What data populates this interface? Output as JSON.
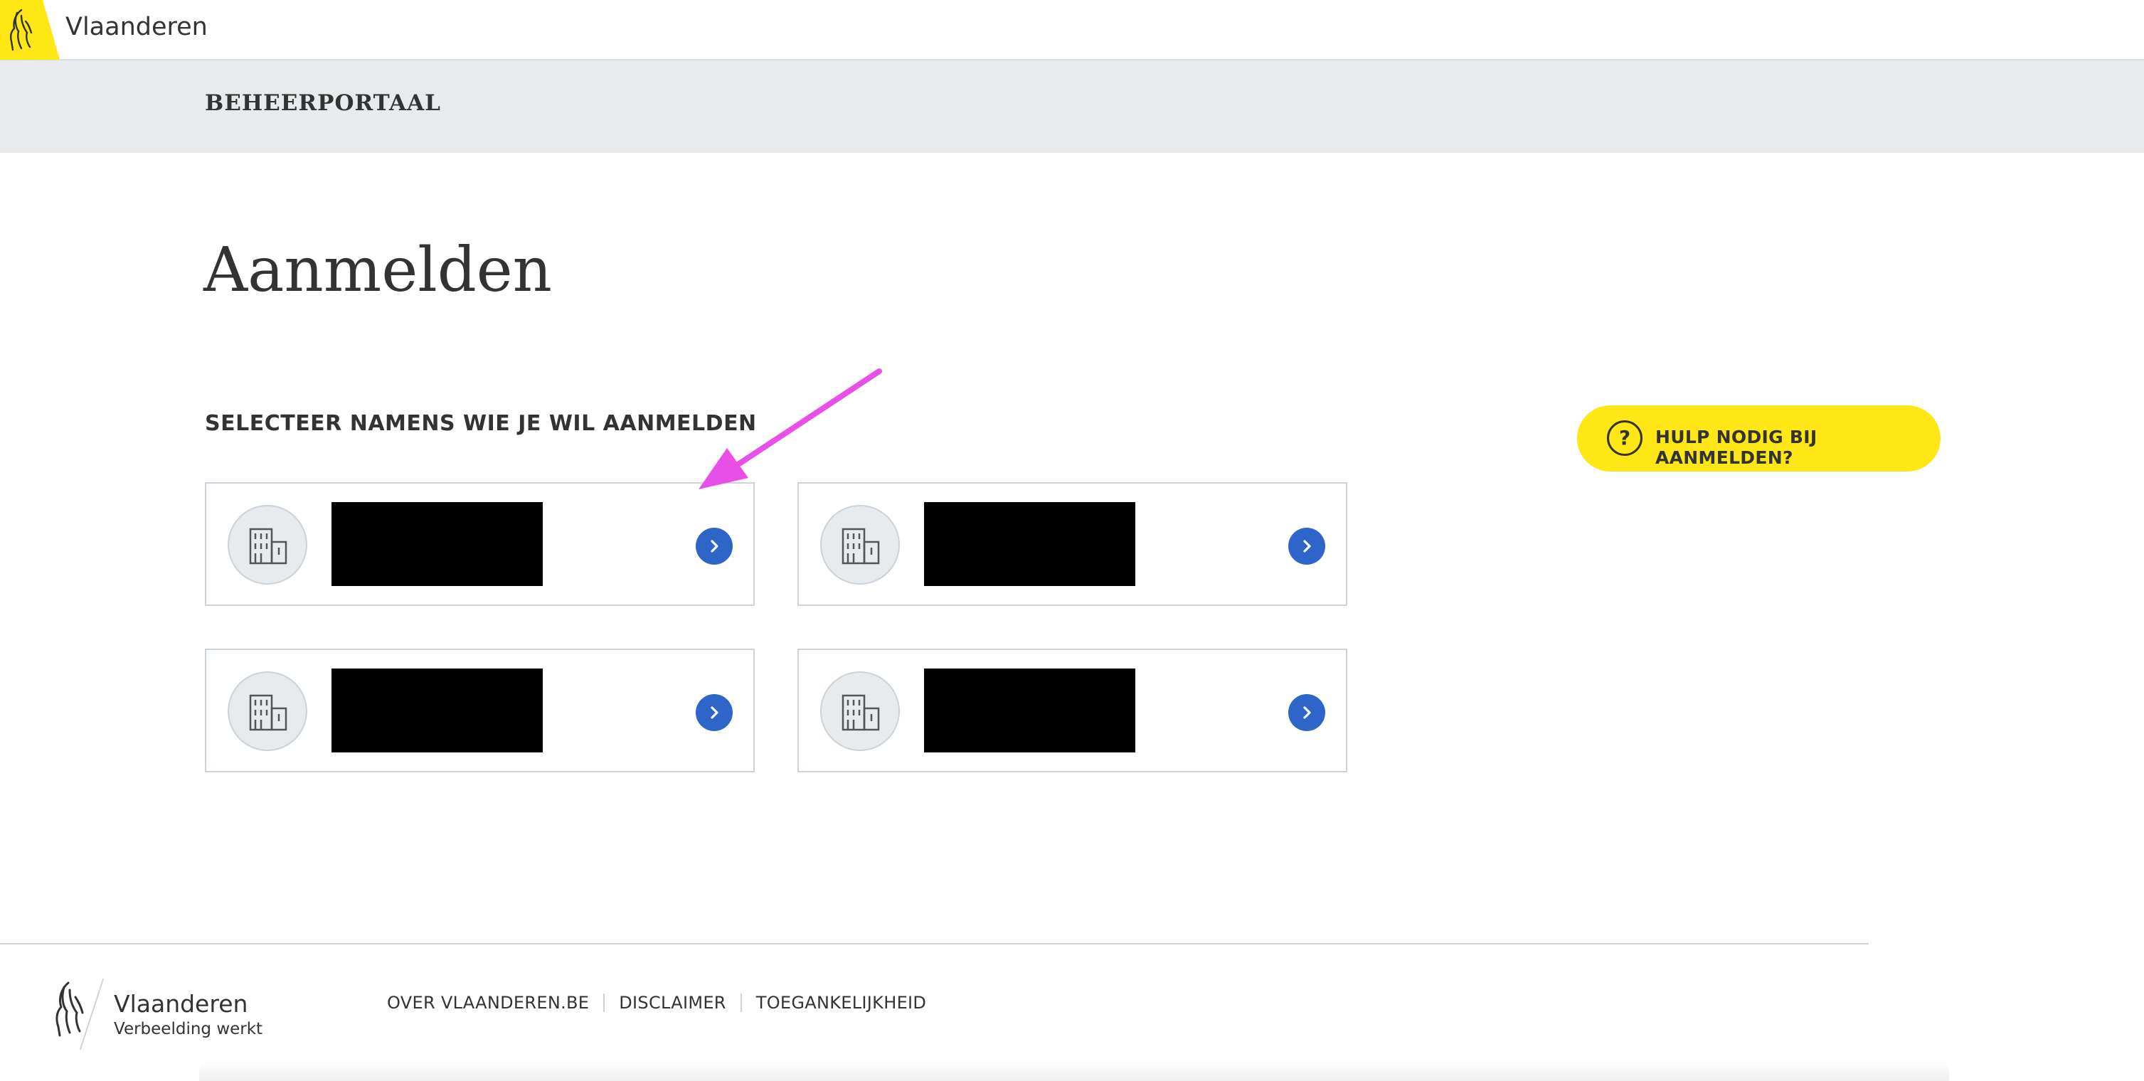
{
  "header": {
    "brand": "Vlaanderen"
  },
  "subheader": {
    "portal_name": "BEHEERPORTAAL"
  },
  "main": {
    "title": "Aanmelden",
    "section_label": "SELECTEER NAMENS WIE JE WIL AANMELDEN",
    "cards": [
      {
        "icon": "building-icon",
        "name": "",
        "action_icon": "chevron-right-icon"
      },
      {
        "icon": "building-icon",
        "name": "",
        "action_icon": "chevron-right-icon"
      },
      {
        "icon": "building-icon",
        "name": "",
        "action_icon": "chevron-right-icon"
      },
      {
        "icon": "building-icon",
        "name": "",
        "action_icon": "chevron-right-icon"
      }
    ]
  },
  "help_button": {
    "icon": "question-icon",
    "label": "HULP NODIG BIJ AANMELDEN?"
  },
  "footer": {
    "brand": "Vlaanderen",
    "tagline": "Verbeelding werkt",
    "links": [
      {
        "label": "OVER VLAANDEREN.BE"
      },
      {
        "label": "DISCLAIMER"
      },
      {
        "label": "TOEGANKELIJKHEID"
      }
    ]
  },
  "colors": {
    "flanders_yellow": "#ffe615",
    "action_blue": "#2f64c8",
    "subbar_grey": "#e8ebee",
    "text_dark": "#333332",
    "annotation_magenta": "#e84fe6"
  }
}
